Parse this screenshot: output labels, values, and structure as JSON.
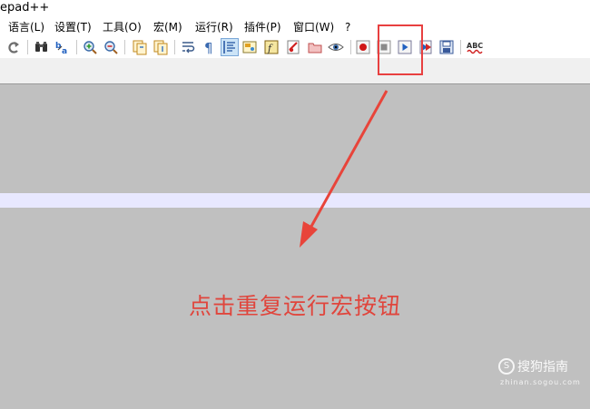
{
  "window": {
    "title": "epad++"
  },
  "menu": [
    {
      "label": "语言(L)"
    },
    {
      "label": "设置(T)"
    },
    {
      "label": "工具(O)"
    },
    {
      "label": "宏(M)"
    },
    {
      "label": "运行(R)"
    },
    {
      "label": "插件(P)"
    },
    {
      "label": "窗口(W)"
    },
    {
      "label": "?"
    }
  ],
  "toolbar": {
    "icons": [
      "redo-icon",
      "find-icon",
      "replace-icon",
      "zoom-in-icon",
      "zoom-out-icon",
      "sync-vertical-icon",
      "sync-horizontal-icon",
      "word-wrap-icon",
      "show-all-chars-icon",
      "indent-guide-icon",
      "document-map-icon",
      "function-list-icon",
      "folder-workspace-icon",
      "folder-icon",
      "monitor-icon",
      "record-macro-icon",
      "stop-record-icon",
      "playback-macro-icon",
      "run-macro-multiple-icon",
      "save-macro-icon",
      "spell-check-icon"
    ],
    "spell_check_label": "ABC"
  },
  "annotation": {
    "caption": "点击重复运行宏按钮",
    "highlight_color": "#e84040"
  },
  "watermark": {
    "logo": "S",
    "text": "搜狗指南",
    "url": "zhinan.sogou.com"
  },
  "colors": {
    "editor_bg": "#c0c0c0",
    "current_line": "#e8e8ff",
    "caption": "#e0453c"
  }
}
